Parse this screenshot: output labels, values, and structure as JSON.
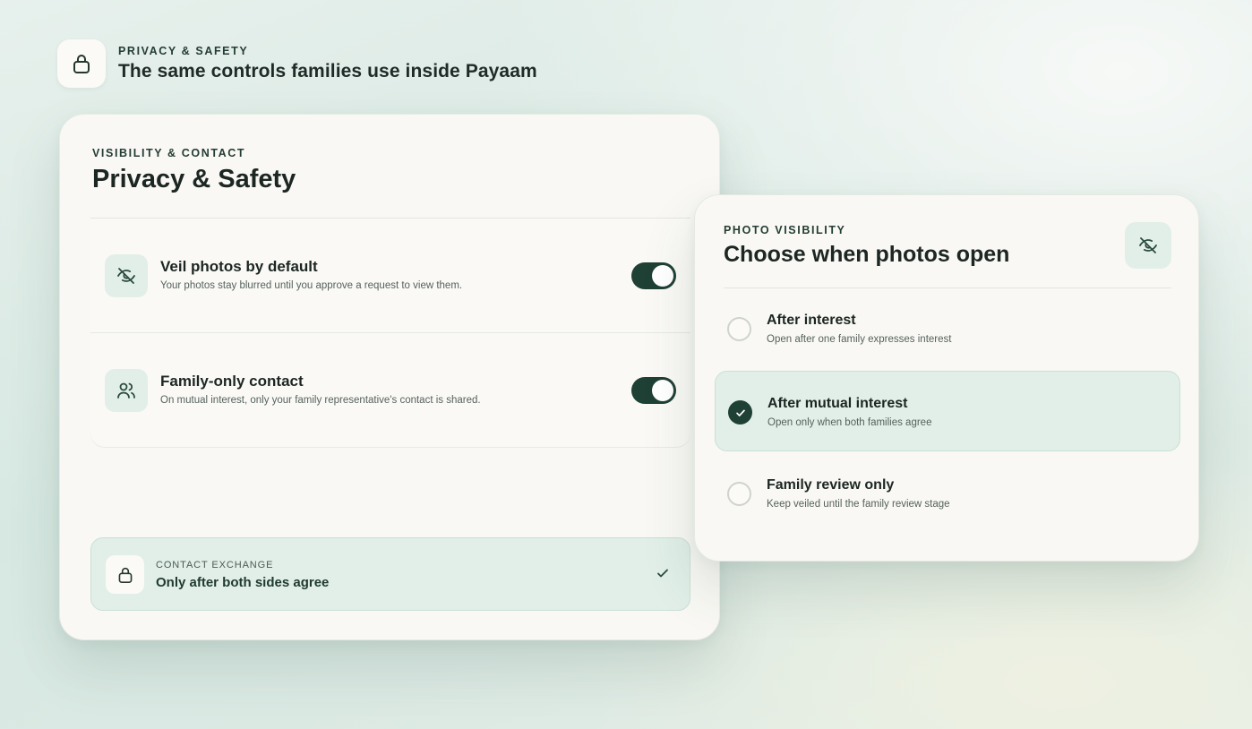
{
  "header": {
    "eyebrow": "PRIVACY & SAFETY",
    "title": "The same controls families use inside Payaam",
    "icon": "lock-icon"
  },
  "privacy_card": {
    "eyebrow": "VISIBILITY & CONTACT",
    "title": "Privacy & Safety",
    "settings": [
      {
        "icon": "eye-off-icon",
        "title": "Veil photos by default",
        "description": "Your photos stay blurred until you approve a request to view them.",
        "enabled": true
      },
      {
        "icon": "users-icon",
        "title": "Family-only contact",
        "description": "On mutual interest, only your family representative's contact is shared.",
        "enabled": true
      }
    ],
    "contact_exchange": {
      "label": "CONTACT EXCHANGE",
      "value": "Only after both sides agree",
      "icon": "lock-icon",
      "status_icon": "check-icon"
    }
  },
  "photo_card": {
    "eyebrow": "PHOTO VISIBILITY",
    "title": "Choose when photos open",
    "icon": "eye-off-icon",
    "options": [
      {
        "title": "After interest",
        "description": "Open after one family expresses interest",
        "selected": false
      },
      {
        "title": "After mutual interest",
        "description": "Open only when both families agree",
        "selected": true
      },
      {
        "title": "Family review only",
        "description": "Keep veiled until the family review stage",
        "selected": false
      }
    ]
  },
  "colors": {
    "accent_dark": "#1f4034",
    "accent_light": "#e1efe8",
    "card_bg": "#f9f8f4"
  }
}
